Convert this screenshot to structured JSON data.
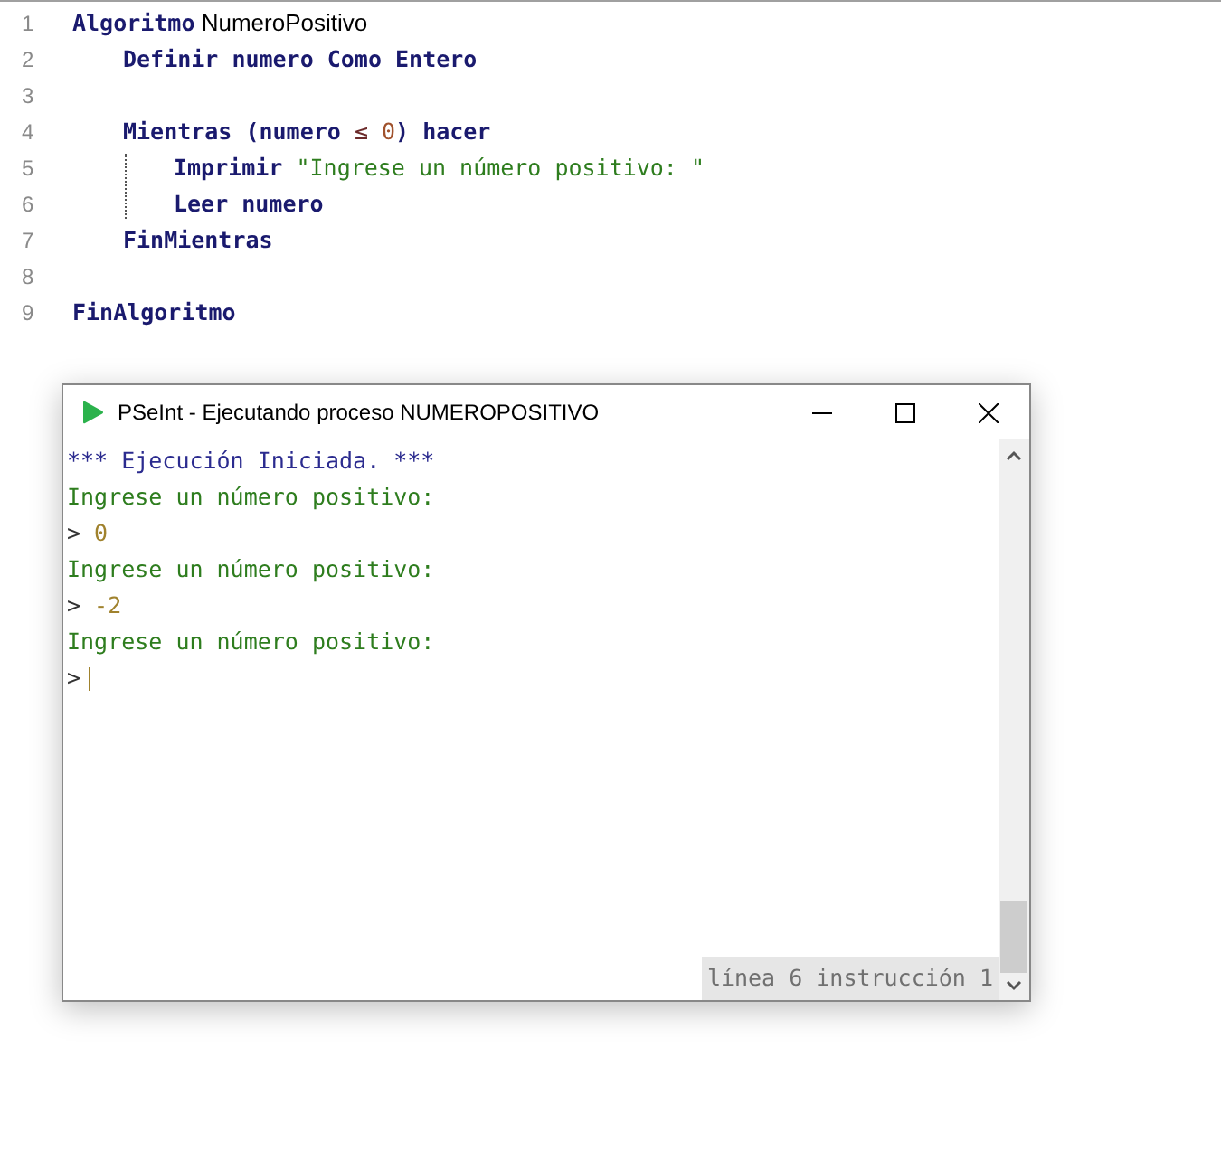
{
  "editor": {
    "lines": [
      {
        "number": "1",
        "tokens": [
          {
            "kind": "keyword",
            "text": "Algoritmo"
          },
          {
            "kind": "name",
            "text": " NumeroPositivo"
          }
        ],
        "children": [
          {
            "number": "2",
            "tokens": [
              {
                "kind": "keyword",
                "text": "Definir numero Como Entero"
              }
            ]
          },
          {
            "number": "3"
          },
          {
            "number": "4",
            "tokens": [
              {
                "kind": "keyword",
                "text": "Mientras (numero "
              },
              {
                "kind": "operator",
                "text": "≤"
              },
              {
                "kind": "number",
                "text": " 0"
              },
              {
                "kind": "keyword",
                "text": ") hacer"
              }
            ],
            "children": [
              {
                "number": "5",
                "tokens": [
                  {
                    "kind": "keyword",
                    "text": "Imprimir"
                  },
                  {
                    "kind": "string",
                    "text": " \"Ingrese un número positivo: \""
                  }
                ]
              },
              {
                "number": "6",
                "tokens": [
                  {
                    "kind": "keyword",
                    "text": "Leer numero"
                  }
                ]
              }
            ]
          },
          {
            "number": "7",
            "tokens": [
              {
                "kind": "keyword",
                "text": "FinMientras"
              }
            ]
          },
          {
            "number": "8"
          }
        ]
      },
      {
        "number": "9",
        "tokens": [
          {
            "kind": "keyword",
            "text": "FinAlgoritmo"
          }
        ]
      }
    ]
  },
  "run_window": {
    "title": "PSeInt - Ejecutando proceso NUMEROPOSITIVO",
    "console": [
      {
        "kind": "info",
        "text": "*** Ejecución Iniciada. ***"
      },
      {
        "kind": "output",
        "text": "Ingrese un número positivo:"
      },
      {
        "kind": "input",
        "prompt": ">",
        "value": " 0",
        "cursor": false
      },
      {
        "kind": "output",
        "text": "Ingrese un número positivo:"
      },
      {
        "kind": "input",
        "prompt": ">",
        "value": " -2",
        "cursor": false
      },
      {
        "kind": "output",
        "text": "Ingrese un número positivo:"
      },
      {
        "kind": "input",
        "prompt": ">",
        "cursor": true
      }
    ],
    "status": "línea 6 instrucción 1"
  }
}
